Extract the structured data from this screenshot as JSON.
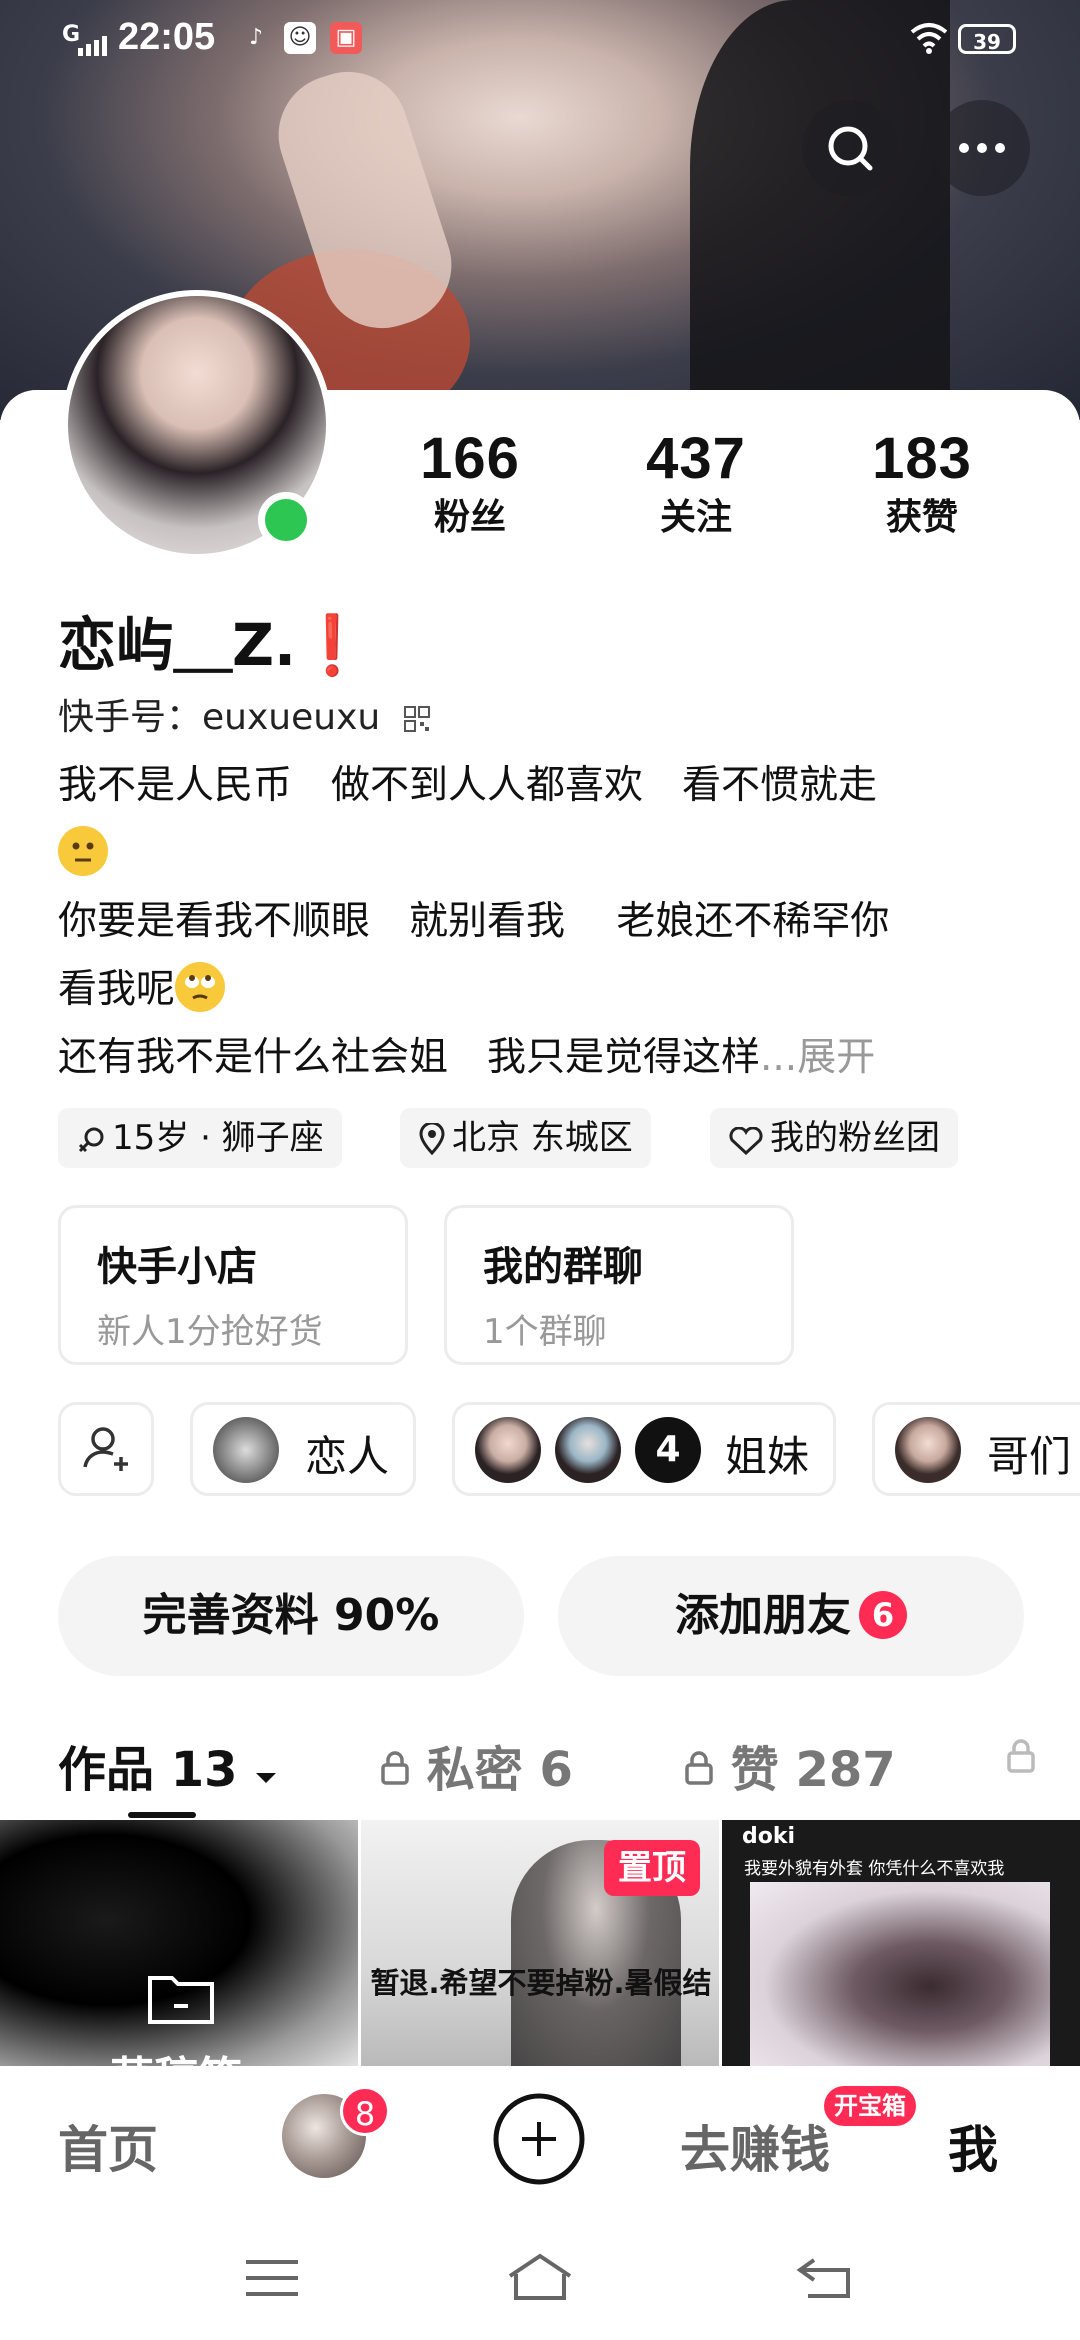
{
  "status_bar": {
    "signal": "G",
    "time": "22:05",
    "battery": "39"
  },
  "profile": {
    "stats": [
      {
        "value": "166",
        "label": "粉丝"
      },
      {
        "value": "437",
        "label": "关注"
      },
      {
        "value": "183",
        "label": "获赞"
      }
    ],
    "name": "恋屿＿Z.",
    "name_mark": "❗",
    "kuaishou_id_label": "快手号：",
    "kuaishou_id": "euxueuxu",
    "bio_lines": [
      "我不是人民币　做不到人人都喜欢　看不惯就走",
      "你要是看我不顺眼　就别看我　 老娘还不稀罕你",
      "看我呢",
      "还有我不是什么社会姐　我只是觉得这样"
    ],
    "bio_ellipsis": "...",
    "bio_expand": "展开",
    "tags": [
      "15岁 · 狮子座",
      "北京 东城区",
      "我的粉丝团"
    ]
  },
  "shortcuts": [
    {
      "title": "快手小店",
      "subtitle": "新人1分抢好货"
    },
    {
      "title": "我的群聊",
      "subtitle": "1个群聊"
    }
  ],
  "groups": {
    "items": [
      "恋人",
      "姐妹",
      "哥们"
    ],
    "sisters_extra_count": "4"
  },
  "actions": {
    "complete_profile": "完善资料 90%",
    "add_friends": "添加朋友",
    "add_friends_badge": "6"
  },
  "tabs": {
    "works": "作品 13",
    "private_label": "私密",
    "private_count": "6",
    "likes_label": "赞",
    "likes_count": "287"
  },
  "thumbnails": {
    "draft_partial": "草稿箱",
    "pinned_badge": "置顶",
    "caption_2": "暂退.希望不要掉粉.暑假结",
    "thumb3_logo": "doki",
    "caption_3": "我要外貌有外套 你凭什么不喜欢我"
  },
  "bottom_nav": {
    "home": "首页",
    "messages_badge": "8",
    "earn": "去赚钱",
    "earn_badge": "开宝箱",
    "me": "我"
  }
}
